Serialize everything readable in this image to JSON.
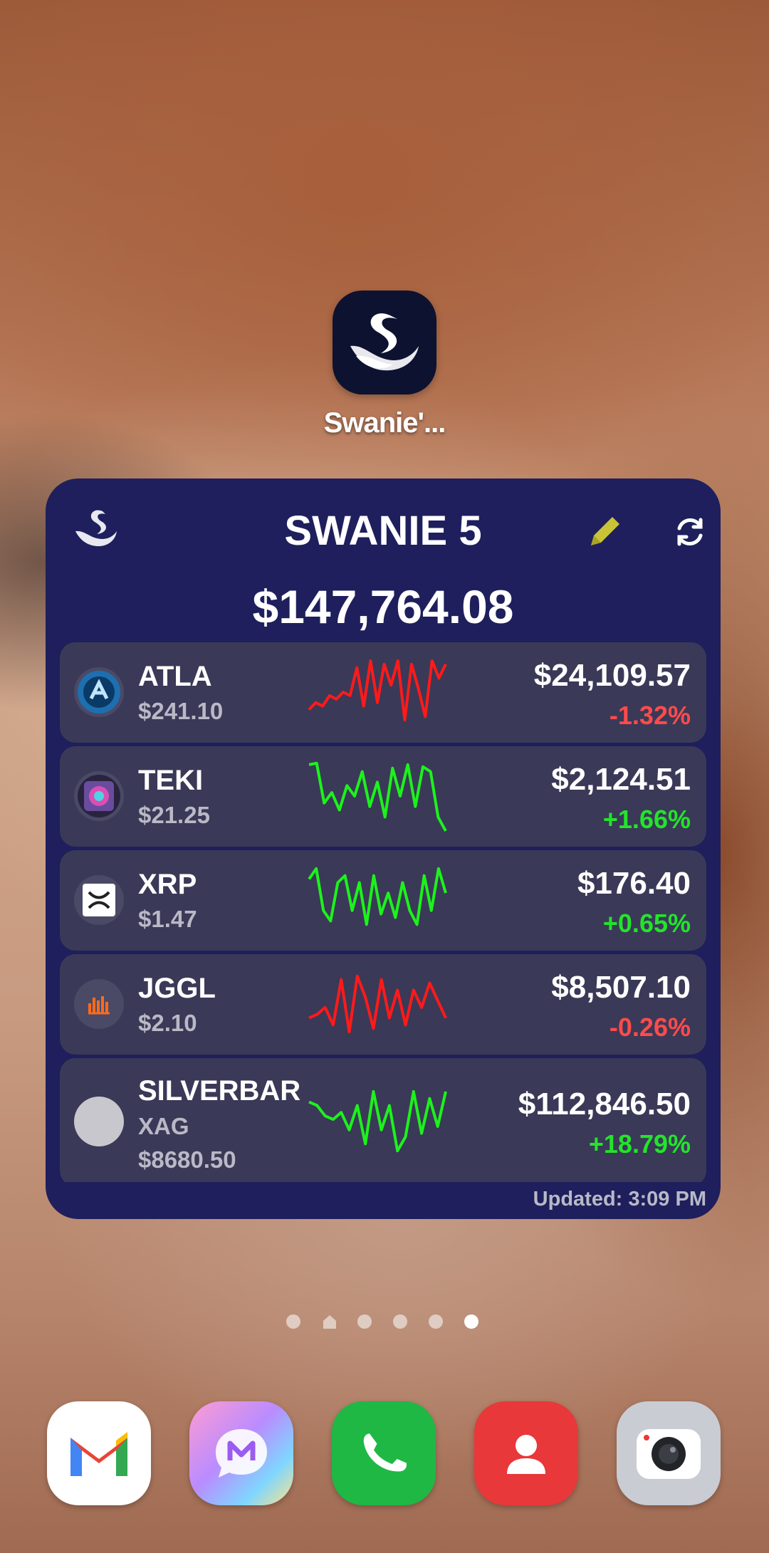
{
  "home_shortcut": {
    "label": "Swanie'...",
    "icon": "swan-icon"
  },
  "widget": {
    "title": "SWANIE 5",
    "total": "$147,764.08",
    "updated": "Updated: 3:09 PM",
    "icons": {
      "logo": "swan-icon",
      "edit": "pencil-icon",
      "refresh": "refresh-icon"
    },
    "colors": {
      "background": "#1e1f5c",
      "row": "#3a3957",
      "negative": "#ff4b4b",
      "positive": "#23e42b"
    },
    "holdings": [
      {
        "symbol": "ATLA",
        "price": "$241.10",
        "value": "$24,109.57",
        "change": "-1.32%",
        "trend": "negative",
        "spark": [
          0.25,
          0.35,
          0.3,
          0.45,
          0.4,
          0.5,
          0.45,
          0.85,
          0.3,
          0.95,
          0.35,
          0.9,
          0.6,
          0.95,
          0.1,
          0.9,
          0.55,
          0.15,
          0.95,
          0.7,
          0.9
        ]
      },
      {
        "symbol": "TEKI",
        "price": "$21.25",
        "value": "$2,124.51",
        "change": "+1.66%",
        "trend": "positive",
        "spark": [
          0.95,
          0.97,
          0.4,
          0.55,
          0.3,
          0.65,
          0.5,
          0.85,
          0.35,
          0.7,
          0.2,
          0.9,
          0.5,
          0.95,
          0.35,
          0.92,
          0.85,
          0.2,
          0.0
        ]
      },
      {
        "symbol": "XRP",
        "price": "$1.47",
        "value": "$176.40",
        "change": "+0.65%",
        "trend": "positive",
        "spark": [
          0.8,
          0.95,
          0.35,
          0.2,
          0.75,
          0.85,
          0.35,
          0.75,
          0.15,
          0.85,
          0.3,
          0.6,
          0.25,
          0.75,
          0.35,
          0.15,
          0.85,
          0.35,
          0.95,
          0.6
        ]
      },
      {
        "symbol": "JGGL",
        "price": "$2.10",
        "value": "$8,507.10",
        "change": "-0.26%",
        "trend": "negative",
        "spark": [
          0.3,
          0.35,
          0.45,
          0.2,
          0.85,
          0.1,
          0.9,
          0.6,
          0.15,
          0.85,
          0.3,
          0.7,
          0.2,
          0.7,
          0.45,
          0.8,
          0.55,
          0.3
        ]
      },
      {
        "symbol": "SILVERBAR",
        "ticker": "XAG",
        "price": "$8680.50",
        "value": "$112,846.50",
        "change": "+18.79%",
        "trend": "positive",
        "spark": [
          0.8,
          0.75,
          0.6,
          0.55,
          0.65,
          0.4,
          0.75,
          0.2,
          0.95,
          0.4,
          0.75,
          0.1,
          0.3,
          0.95,
          0.35,
          0.85,
          0.45,
          0.95
        ]
      }
    ]
  },
  "page_indicator": {
    "count": 6,
    "active": 5,
    "home_index": 1
  },
  "dock": [
    {
      "name": "gmail",
      "icon": "gmail-icon"
    },
    {
      "name": "messages",
      "icon": "messages-icon"
    },
    {
      "name": "phone",
      "icon": "phone-icon"
    },
    {
      "name": "contacts",
      "icon": "contacts-icon"
    },
    {
      "name": "camera",
      "icon": "camera-icon"
    }
  ]
}
